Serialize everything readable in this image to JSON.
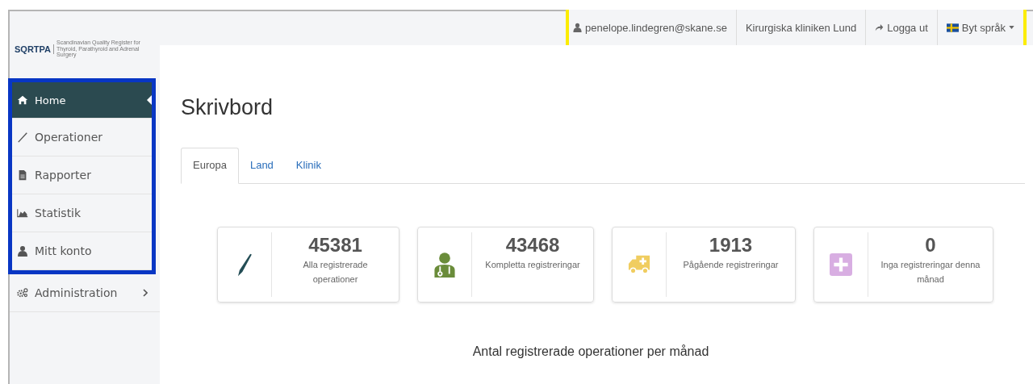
{
  "logo": {
    "name": "SQRTPA",
    "tagline": "Scandinavian Quality Register for Thyroid, Parathyroid and Adrenal Surgery"
  },
  "top_nav": [
    {
      "kind": "user",
      "label": "penelope.lindegren@skane.se"
    },
    {
      "kind": "text",
      "label": "Kirurgiska kliniken Lund"
    },
    {
      "kind": "logout",
      "label": "Logga ut"
    },
    {
      "kind": "language",
      "label": "Byt språk"
    }
  ],
  "sidebar": {
    "items": [
      {
        "kind": "home",
        "label": "Home",
        "selected": true,
        "submenu": false
      },
      {
        "kind": "pen",
        "label": "Operationer",
        "selected": false,
        "submenu": false
      },
      {
        "kind": "file",
        "label": "Rapporter",
        "selected": false,
        "submenu": false
      },
      {
        "kind": "chart",
        "label": "Statistik",
        "selected": false,
        "submenu": false
      },
      {
        "kind": "user",
        "label": "Mitt konto",
        "selected": false,
        "submenu": false
      },
      {
        "kind": "gears",
        "label": "Administration",
        "selected": false,
        "submenu": true
      }
    ]
  },
  "page": {
    "title": "Skrivbord"
  },
  "tabs": [
    {
      "label": "Europa",
      "selected": true
    },
    {
      "label": "Land",
      "selected": false
    },
    {
      "label": "Klinik",
      "selected": false
    }
  ],
  "cards": [
    {
      "kind": "scalpel",
      "color": "#234d55",
      "value": "45381",
      "label": "Alla registrerade operationer"
    },
    {
      "kind": "doctor",
      "color": "#6a8c3a",
      "value": "43468",
      "label": "Kompletta registreringar"
    },
    {
      "kind": "ambulance",
      "color": "#f0cd60",
      "value": "1913",
      "label": "Pågående registreringar"
    },
    {
      "kind": "plus",
      "color": "#d8aee2",
      "value": "0",
      "label": "Inga registreringar denna månad"
    }
  ],
  "chart_title": "Antal registrerade operationer per månad"
}
